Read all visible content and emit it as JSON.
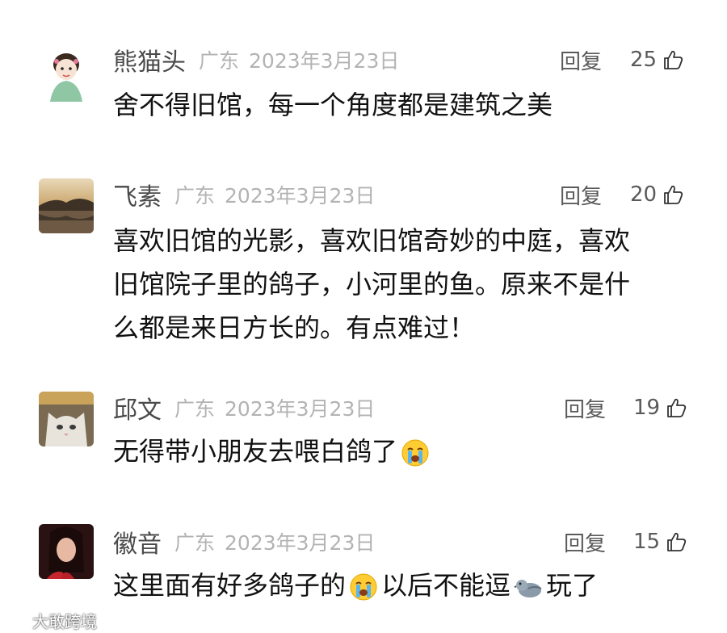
{
  "comments": [
    {
      "username": "熊猫头",
      "location": "广东",
      "date": "2023年3月23日",
      "reply_label": "回复",
      "likes": "25",
      "text": "舍不得旧馆，每一个角度都是建筑之美"
    },
    {
      "username": "飞素",
      "location": "广东",
      "date": "2023年3月23日",
      "reply_label": "回复",
      "likes": "20",
      "text_lines": [
        "喜欢旧馆的光影，喜欢旧馆奇妙的中庭，喜欢",
        "旧馆院子里的鸽子，小河里的鱼。原来不是什",
        "么都是来日方长的。有点难过！"
      ]
    },
    {
      "username": "邱文",
      "location": "广东",
      "date": "2023年3月23日",
      "reply_label": "回复",
      "likes": "19",
      "text": "无得带小朋友去喂白鸽了"
    },
    {
      "username": "徽音",
      "location": "广东",
      "date": "2023年3月23日",
      "reply_label": "回复",
      "likes": "15",
      "text_part1": "这里面有好多鸽子的",
      "text_part2": "以后不能逗",
      "text_part3": "玩了"
    }
  ],
  "watermark": "大敢跨境",
  "icons": {
    "thumb": "thumbs-up-icon",
    "crying": "crying-emoji-icon",
    "pigeon": "pigeon-emoji-icon"
  }
}
